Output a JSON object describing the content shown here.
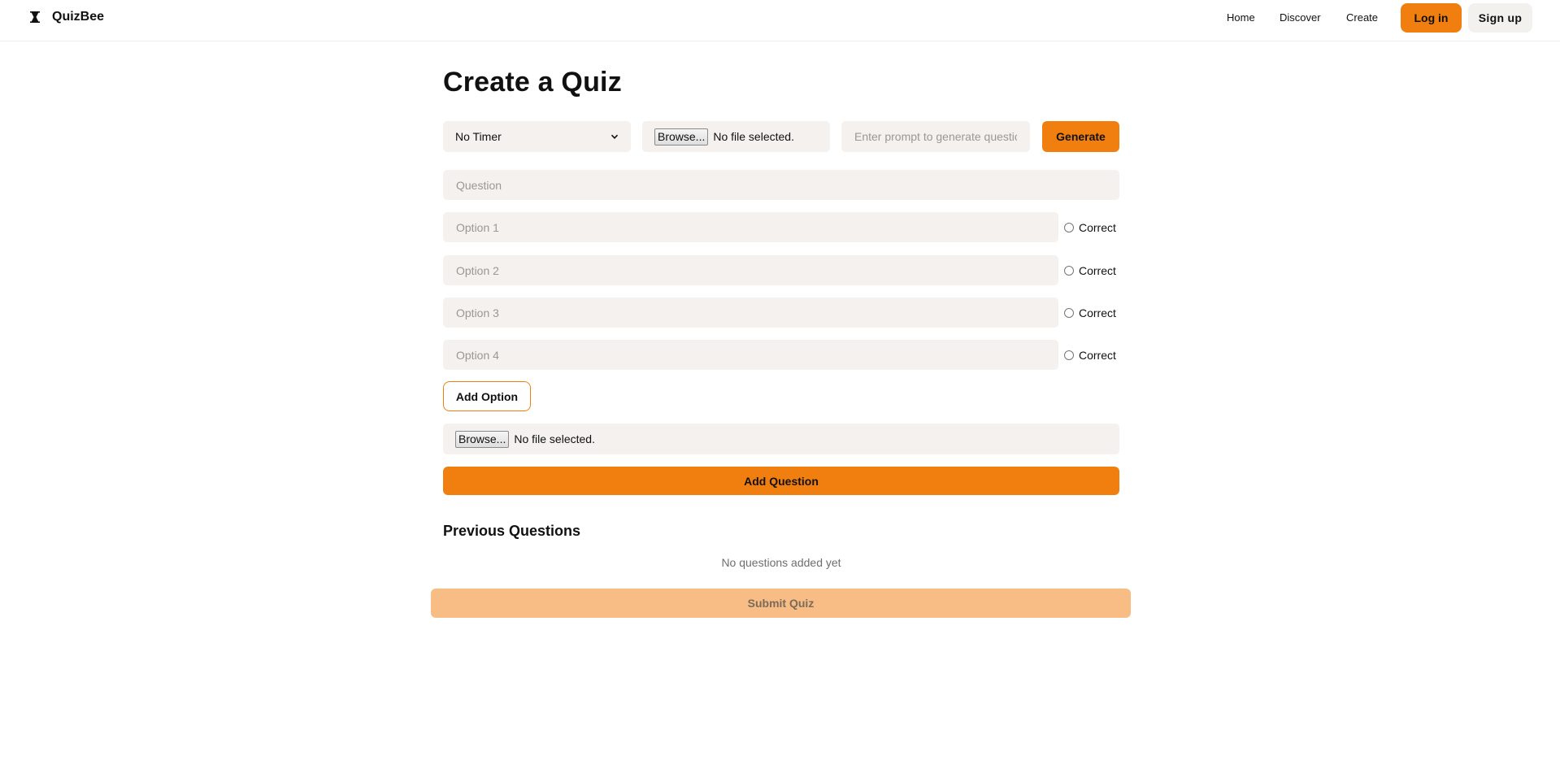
{
  "header": {
    "brand_name": "QuizBee",
    "nav": {
      "home": "Home",
      "discover": "Discover",
      "create": "Create"
    },
    "login_label": "Log in",
    "signup_label": "Sign up"
  },
  "main": {
    "title": "Create a Quiz",
    "timer_select": {
      "value": "No Timer"
    },
    "quiz_file": {
      "button": "Browse...",
      "status": "No file selected."
    },
    "prompt_input": {
      "placeholder": "Enter prompt to generate questions"
    },
    "generate_label": "Generate",
    "question_input": {
      "placeholder": "Question"
    },
    "options": [
      {
        "placeholder": "Option 1",
        "correct_label": "Correct"
      },
      {
        "placeholder": "Option 2",
        "correct_label": "Correct"
      },
      {
        "placeholder": "Option 3",
        "correct_label": "Correct"
      },
      {
        "placeholder": "Option 4",
        "correct_label": "Correct"
      }
    ],
    "add_option_label": "Add Option",
    "question_file": {
      "button": "Browse...",
      "status": "No file selected."
    },
    "add_question_label": "Add Question",
    "previous_title": "Previous Questions",
    "empty_text": "No questions added yet",
    "submit_label": "Submit Quiz"
  },
  "colors": {
    "accent": "#f17f10",
    "accent_disabled": "#f8bd85",
    "field_bg": "#f4f1ee"
  }
}
